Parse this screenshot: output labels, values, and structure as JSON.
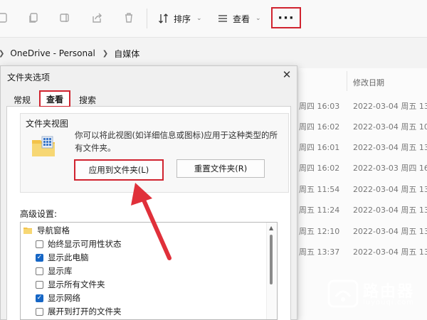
{
  "toolbar": {
    "sort_label": "排序",
    "view_label": "查看",
    "more_label": "···",
    "icons": [
      "new-icon",
      "copy-icon",
      "rename-icon",
      "share-icon",
      "delete-icon"
    ]
  },
  "address": {
    "crumbs": [
      "OneDrive - Personal",
      "自媒体"
    ]
  },
  "file_list": {
    "column_header": "修改日期",
    "rows": [
      {
        "left": "周四 16:03",
        "right": "2022-03-04 周五 13"
      },
      {
        "left": "周四 16:02",
        "right": "2022-03-04 周五 10"
      },
      {
        "left": "周四 16:01",
        "right": "2022-03-04 周五 13"
      },
      {
        "left": "周四 16:02",
        "right": "2022-03-03 周四 16"
      },
      {
        "left": "周五 11:54",
        "right": "2022-03-04 周五 13"
      },
      {
        "left": "周五 11:24",
        "right": "2022-03-04 周五 13"
      },
      {
        "left": "周五 12:10",
        "right": "2022-03-04 周五 13"
      },
      {
        "left": "周五 13:37",
        "right": "2022-03-04 周五 13"
      }
    ]
  },
  "dialog": {
    "title": "文件夹选项",
    "close_label": "✕",
    "tabs": [
      "常规",
      "查看",
      "搜索"
    ],
    "active_tab": "查看",
    "folder_view": {
      "title": "文件夹视图",
      "description": "你可以将此视图(如详细信息或图标)应用于这种类型的所有文件夹。",
      "apply_button": "应用到文件夹(L)",
      "reset_button": "重置文件夹(R)"
    },
    "advanced_label": "高级设置:",
    "tree": {
      "node_label": "导航窗格",
      "items": [
        {
          "label": "始终显示可用性状态",
          "checked": false
        },
        {
          "label": "显示此电脑",
          "checked": true
        },
        {
          "label": "显示库",
          "checked": false
        },
        {
          "label": "显示所有文件夹",
          "checked": false
        },
        {
          "label": "显示网络",
          "checked": true
        },
        {
          "label": "展开到打开的文件夹",
          "checked": false
        }
      ]
    }
  },
  "watermark": {
    "text": "路由器",
    "url": "luyouqi.com"
  },
  "colors": {
    "highlight_red": "#d0232f",
    "checkbox_blue": "#1666c5"
  }
}
